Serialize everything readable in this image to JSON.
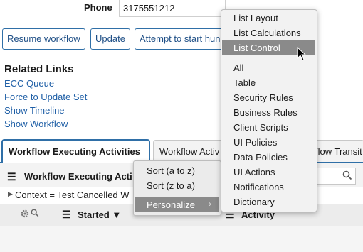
{
  "form": {
    "phone_label": "Phone",
    "phone_value": "3175551212"
  },
  "actions": [
    {
      "label": "Resume workflow"
    },
    {
      "label": "Update"
    },
    {
      "label": "Attempt to start hung"
    }
  ],
  "related": {
    "title": "Related Links",
    "links": [
      "ECC Queue",
      "Force to Update Set",
      "Show Timeline",
      "Show Workflow"
    ]
  },
  "tabs": [
    {
      "label": "Workflow Executing Activities",
      "active": true
    },
    {
      "label": "Workflow Activ",
      "active": false
    },
    {
      "label": "flow Transit",
      "active": false
    }
  ],
  "list": {
    "header_title": "Workflow Executing Acti",
    "condition": "Context = Test Cancelled W",
    "columns": [
      "Started ▼",
      "Activity"
    ]
  },
  "column_menu": {
    "items": [
      "Sort (a to z)",
      "Sort (z to a)"
    ],
    "highlighted": "Personalize"
  },
  "personalize_menu": {
    "items_top": [
      "List Layout",
      "List Calculations"
    ],
    "highlighted": "List Control",
    "items_bottom": [
      "All",
      "Table",
      "Security Rules",
      "Business Rules",
      "Client Scripts",
      "UI Policies",
      "Data Policies",
      "UI Actions",
      "Notifications",
      "Dictionary"
    ]
  }
}
